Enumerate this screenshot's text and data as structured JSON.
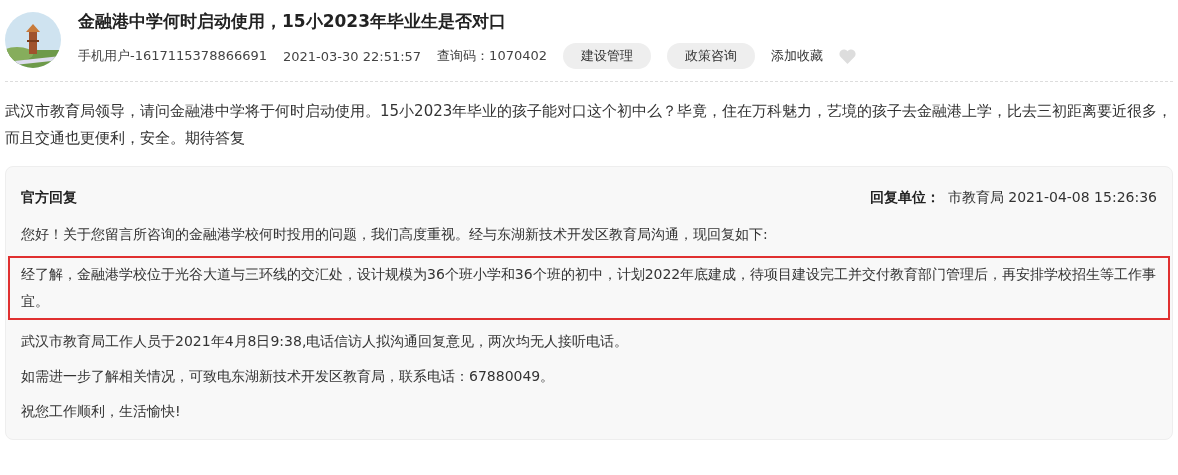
{
  "title": "金融港中学何时启动使用，15小2023年毕业生是否对口",
  "meta": {
    "user": "手机用户-1617115378866691",
    "time": "2021-03-30 22:51:57",
    "query_code": "查询码：1070402",
    "tags": [
      "建设管理",
      "政策咨询"
    ],
    "favorite_label": "添加收藏",
    "favorited": false
  },
  "question": "武汉市教育局领导，请问金融港中学将于何时启动使用。15小2023年毕业的孩子能对口这个初中么？毕竟，住在万科魅力，艺境的孩子去金融港上学，比去三初距离要近很多，而且交通也更便利，安全。期待答复",
  "reply": {
    "heading": "官方回复",
    "unit_label": "回复单位：",
    "unit": "市教育局 2021-04-08 15:26:36",
    "paragraphs": [
      {
        "text": "您好！关于您留言所咨询的金融港学校何时投用的问题，我们高度重视。经与东湖新技术开发区教育局沟通，现回复如下:",
        "highlighted": false
      },
      {
        "text": "经了解，金融港学校位于光谷大道与三环线的交汇处，设计规模为36个班小学和36个班的初中，计划2022年底建成，待项目建设完工并交付教育部门管理后，再安排学校招生等工作事宜。",
        "highlighted": true
      },
      {
        "text": "武汉市教育局工作人员于2021年4月8日9:38,电话信访人拟沟通回复意见，两次均无人接听电话。",
        "highlighted": false
      },
      {
        "text": "如需进一步了解相关情况，可致电东湖新技术开发区教育局，联系电话：67880049。",
        "highlighted": false
      },
      {
        "text": "祝您工作顺利，生活愉快!",
        "highlighted": false
      }
    ]
  }
}
